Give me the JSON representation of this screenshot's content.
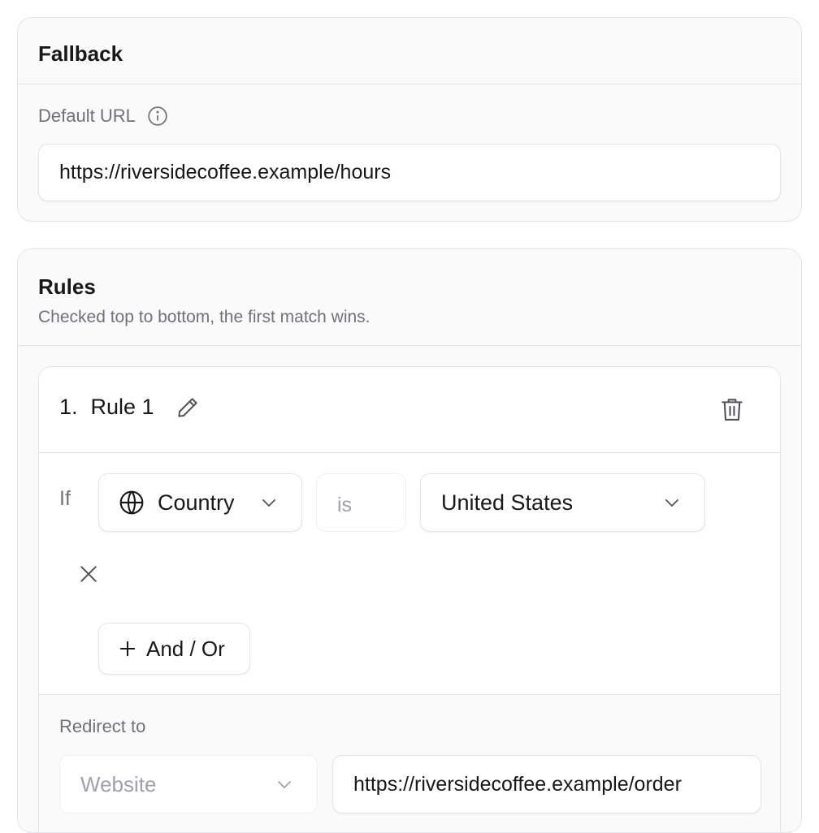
{
  "fallback": {
    "title": "Fallback",
    "default_url_label": "Default URL",
    "default_url_value": "https://riversidecoffee.example/hours"
  },
  "rules": {
    "title": "Rules",
    "subtitle": "Checked top to bottom, the first match wins.",
    "items": [
      {
        "number": "1.",
        "name": "Rule 1",
        "if_label": "If",
        "condition": {
          "field": "Country",
          "operator": "is",
          "value": "United States"
        },
        "add_condition_label": "And / Or",
        "redirect_label": "Redirect to",
        "redirect_type": "Website",
        "redirect_url": "https://riversidecoffee.example/order"
      }
    ]
  },
  "icons": {
    "info": "info-icon",
    "edit": "pencil-icon",
    "delete": "trash-icon",
    "field": "globe-icon",
    "dropdown": "chevron-down-icon",
    "remove": "close-icon",
    "add": "plus-icon"
  },
  "colors": {
    "card_background": "#fafafa",
    "border": "#e4e4e7",
    "text_primary": "#18181b",
    "text_muted": "#71717a",
    "text_disabled": "#a1a1aa"
  }
}
